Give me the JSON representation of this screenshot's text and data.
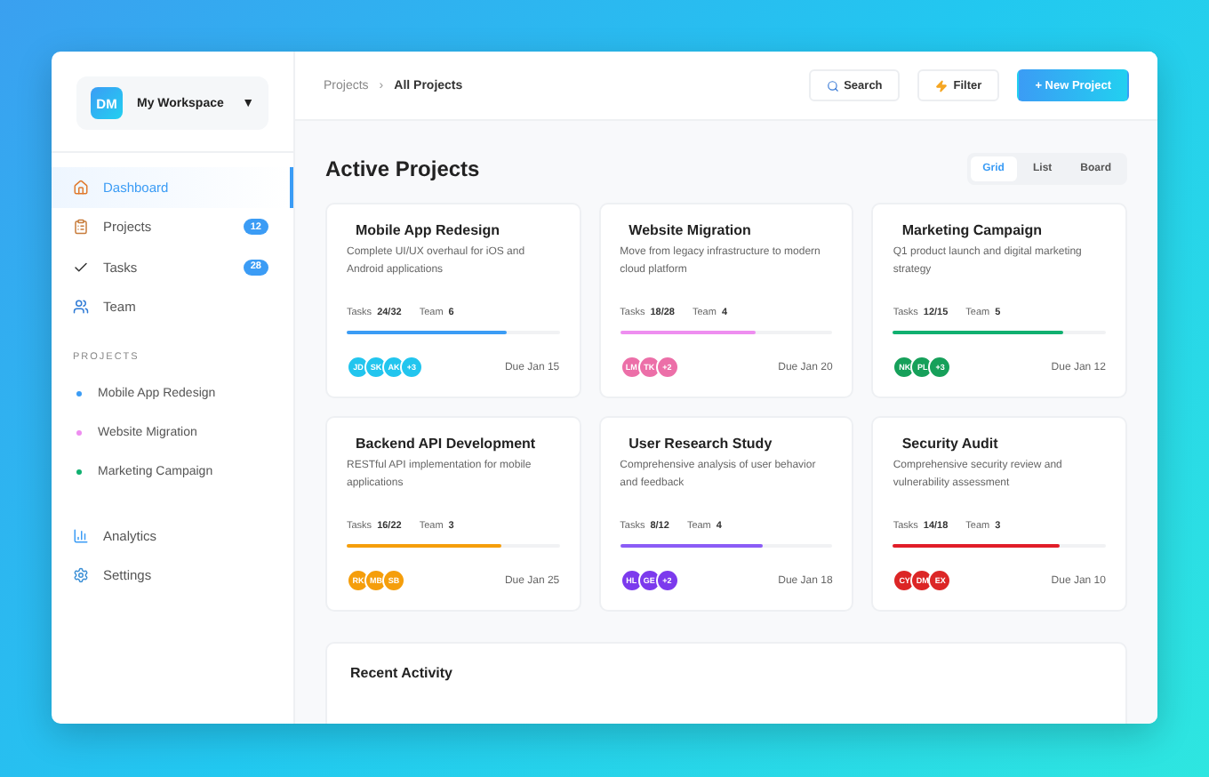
{
  "workspace": {
    "initials": "DM",
    "name": "My Workspace",
    "caret": "▼"
  },
  "nav": [
    {
      "label": "Dashboard",
      "kind": "home",
      "selected": true
    },
    {
      "label": "Projects",
      "kind": "clipboard",
      "selected": false,
      "badge": "12"
    },
    {
      "label": "Tasks",
      "kind": "check",
      "selected": false,
      "badge": "28"
    },
    {
      "label": "Team",
      "kind": "users",
      "selected": false
    }
  ],
  "projects_heading": "PROJECTS",
  "project_links": [
    {
      "label": "Mobile App Redesign",
      "color": "#3b9cf5"
    },
    {
      "label": "Website Migration",
      "color": "#ee8ef0"
    },
    {
      "label": "Marketing Campaign",
      "color": "#10b070"
    }
  ],
  "nav_bottom": [
    {
      "label": "Analytics",
      "kind": "chart",
      "selected": false
    },
    {
      "label": "Settings",
      "kind": "gear",
      "selected": false
    }
  ],
  "breadcrumb": {
    "items": [
      "Projects",
      "All Projects"
    ],
    "separator": "›"
  },
  "actions": [
    {
      "label": "Search",
      "kind": "search"
    },
    {
      "label": "Filter",
      "kind": "filter"
    },
    {
      "label": "+ New Project",
      "kind": "primary"
    }
  ],
  "title": "Active Projects",
  "views": [
    {
      "label": "Grid",
      "selected": true
    },
    {
      "label": "List",
      "selected": false
    },
    {
      "label": "Board",
      "selected": false
    }
  ],
  "cards": [
    {
      "title": "Mobile App Redesign",
      "description": "Complete UI/UX overhaul for iOS and Android applications",
      "tasks_label": "Tasks",
      "tasks": "24/32",
      "team_label": "Team",
      "team": "6",
      "level": 0.75,
      "color": "#3b9cf5",
      "avatars": [
        {
          "initials": "JD",
          "color": "#22c5ee"
        },
        {
          "initials": "SK",
          "color": "#22c5ee"
        },
        {
          "initials": "AK",
          "color": "#22c5ee"
        },
        {
          "initials": "+3",
          "color": "#22c5ee"
        }
      ],
      "due": "Due Jan 15"
    },
    {
      "title": "Website Migration",
      "description": "Move from legacy infrastructure to modern cloud platform",
      "tasks_label": "Tasks",
      "tasks": "18/28",
      "team_label": "Team",
      "team": "4",
      "level": 0.64,
      "color": "#ee8ef0",
      "avatars": [
        {
          "initials": "LM",
          "color": "#ec6fa8"
        },
        {
          "initials": "TK",
          "color": "#ec6fa8"
        },
        {
          "initials": "+2",
          "color": "#ec6fa8"
        }
      ],
      "due": "Due Jan 20"
    },
    {
      "title": "Marketing Campaign",
      "description": "Q1 product launch and digital marketing strategy",
      "tasks_label": "Tasks",
      "tasks": "12/15",
      "team_label": "Team",
      "team": "5",
      "level": 0.8,
      "color": "#10b070",
      "avatars": [
        {
          "initials": "NK",
          "color": "#16a05a"
        },
        {
          "initials": "PL",
          "color": "#16a05a"
        },
        {
          "initials": "+3",
          "color": "#16a05a"
        }
      ],
      "due": "Due Jan 12"
    },
    {
      "title": "Backend API Development",
      "description": "RESTful API implementation for mobile applications",
      "tasks_label": "Tasks",
      "tasks": "16/22",
      "team_label": "Team",
      "team": "3",
      "level": 0.73,
      "color": "#f59e0b",
      "avatars": [
        {
          "initials": "RK",
          "color": "#f59e0b"
        },
        {
          "initials": "MB",
          "color": "#f59e0b"
        },
        {
          "initials": "SB",
          "color": "#f59e0b"
        }
      ],
      "due": "Due Jan 25"
    },
    {
      "title": "User Research Study",
      "description": "Comprehensive analysis of user behavior and feedback",
      "tasks_label": "Tasks",
      "tasks": "8/12",
      "team_label": "Team",
      "team": "4",
      "level": 0.67,
      "color": "#8b5cf6",
      "avatars": [
        {
          "initials": "HL",
          "color": "#7c3aed"
        },
        {
          "initials": "GE",
          "color": "#7c3aed"
        },
        {
          "initials": "+2",
          "color": "#7c3aed"
        }
      ],
      "due": "Due Jan 18"
    },
    {
      "title": "Security Audit",
      "description": "Comprehensive security review and vulnerability assessment",
      "tasks_label": "Tasks",
      "tasks": "14/18",
      "team_label": "Team",
      "team": "3",
      "level": 0.78,
      "color": "#e11d28",
      "avatars": [
        {
          "initials": "CY",
          "color": "#dc2626"
        },
        {
          "initials": "DM",
          "color": "#dc2626"
        },
        {
          "initials": "EX",
          "color": "#dc2626"
        }
      ],
      "due": "Due Jan 10"
    }
  ],
  "recent": {
    "title": "Recent Activity"
  }
}
